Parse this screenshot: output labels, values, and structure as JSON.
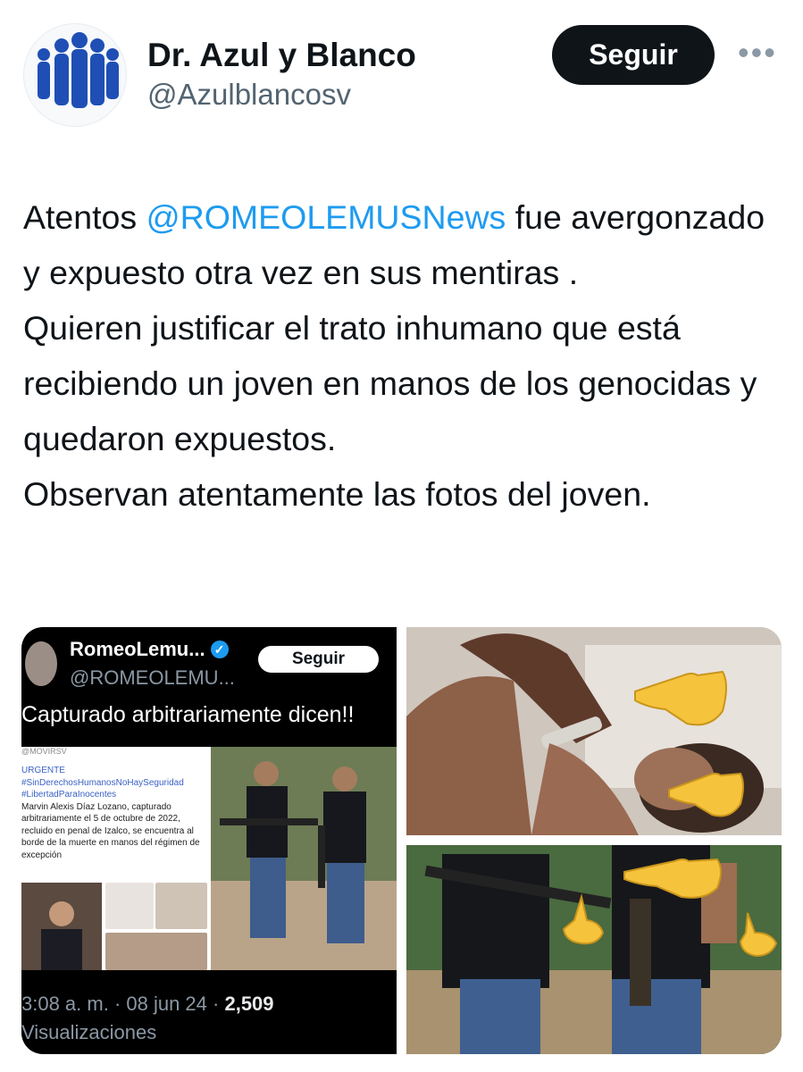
{
  "author": {
    "display_name": "Dr. Azul y Blanco",
    "handle": "@Azulblancosv",
    "follow_label": "Seguir",
    "more_label": "•••"
  },
  "tweet": {
    "text_1": "Atentos ",
    "mention": "@ROMEOLEMUSNews",
    "text_2": " fue avergonzado y expuesto otra vez en sus mentiras .\nQuieren justificar el trato inhumano que está recibiendo un joven en manos de los genocidas y quedaron expuestos.\nObservan atentamente las fotos del joven."
  },
  "embedded_post": {
    "name": "RomeoLemu...",
    "verified_mark": "✓",
    "handle": "@ROMEOLEMU...",
    "follow_label": "Seguir",
    "text": "Capturado arbitrariamente dicen!!",
    "card_header": "@MOVIRSV",
    "card_line_1": "URGENTE",
    "card_line_2": "#SinDerechosHumanosNoHaySeguridad",
    "card_line_3": "#LibertadParaInocentes",
    "card_body": "Marvin Alexis Díaz Lozano, capturado arbitrariamente el 5 de octubre de 2022, recluido en penal de Izalco, se encuentra al borde de la muerte en manos del régimen de excepción",
    "time": "3:08 a. m. · 08 jun 24 · ",
    "views_count": "2,509",
    "views_label": "Visualizaciones"
  },
  "colors": {
    "text": "#0f1419",
    "secondary": "#536471",
    "link": "#1d9bf0",
    "button_bg": "#0f1419"
  },
  "icons": [
    "pointing-hand-emoji",
    "avatar-silhouettes",
    "verified-badge"
  ]
}
